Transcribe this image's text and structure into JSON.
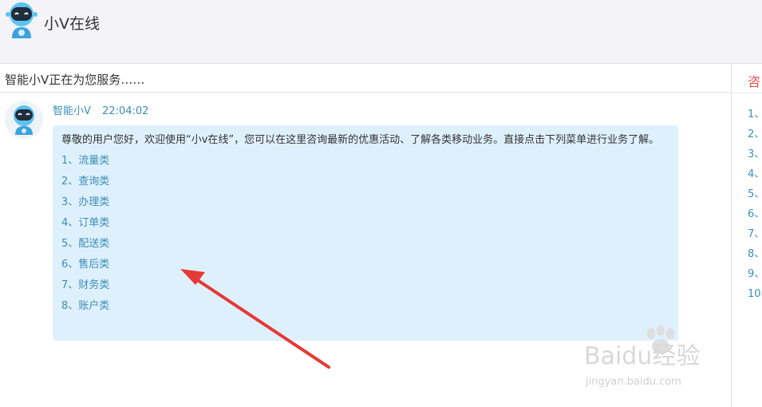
{
  "header": {
    "title": "小V在线",
    "avatar_icon": "robot-avatar-icon"
  },
  "chat": {
    "status": "智能小V正在为您服务……",
    "message": {
      "sender": "智能小V",
      "time": "22:04:02",
      "greeting": "尊敬的用户您好，欢迎使用“小v在线”，您可以在这里咨询最新的优惠活动、了解各类移动业务。直接点击下列菜单进行业务了解。",
      "menu": [
        "1、流量类",
        "2、查询类",
        "3、办理类",
        "4、订单类",
        "5、配送类",
        "6、售后类",
        "7、财务类",
        "8、账户类"
      ]
    }
  },
  "side_panel": {
    "tab_label": "咨",
    "items": [
      "1、",
      "2、",
      "3、",
      "4、",
      "5、",
      "6、",
      "7、",
      "8、",
      "9、",
      "10、"
    ]
  },
  "watermark": {
    "brand": "Baidu经验",
    "url": "jingyan.baidu.com"
  },
  "colors": {
    "accent": "#3a8fb7",
    "bubble": "#dff0fd",
    "arrow": "#e53935",
    "tab": "#e05050"
  }
}
